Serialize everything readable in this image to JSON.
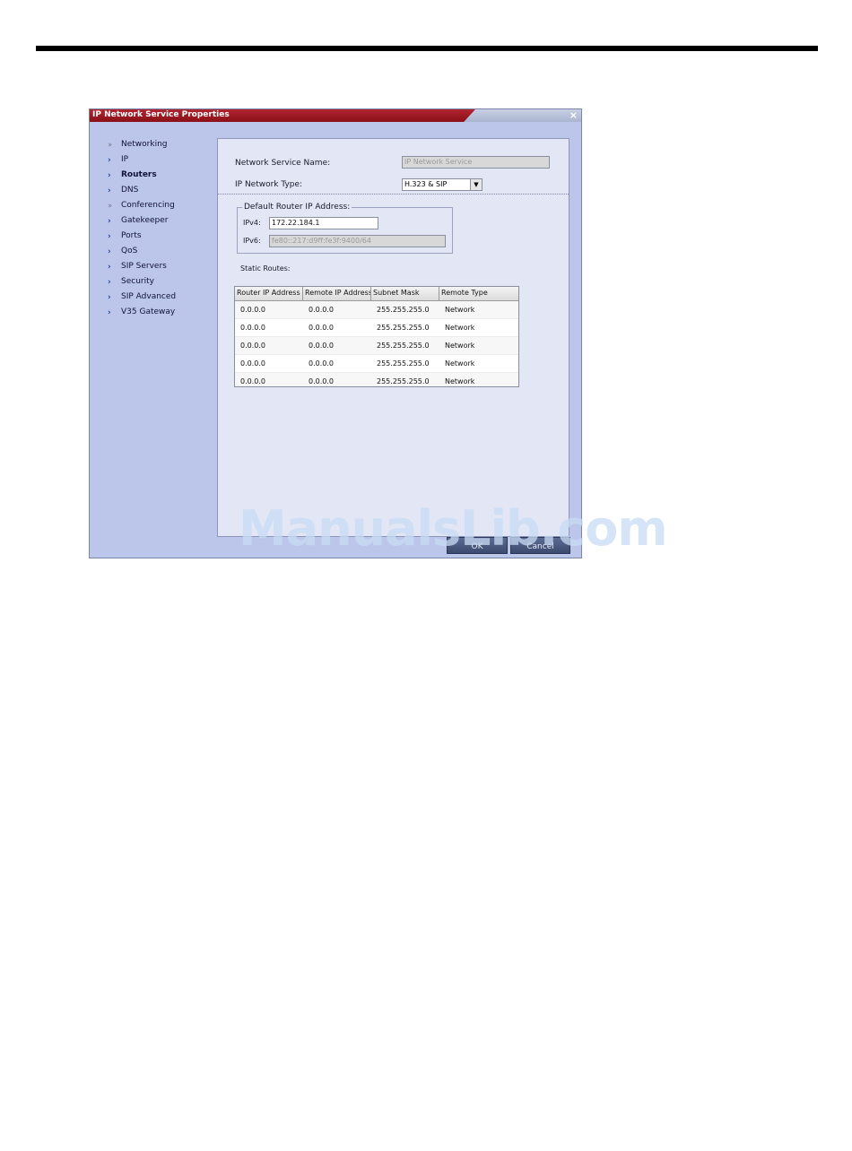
{
  "dialog": {
    "title": "IP Network Service Properties",
    "close_label": "×"
  },
  "nav": {
    "items": [
      {
        "label": "Networking",
        "arrow": "››",
        "section": true
      },
      {
        "label": "IP",
        "arrow": "›",
        "section": false
      },
      {
        "label": "Routers",
        "arrow": "›",
        "section": false,
        "active": true
      },
      {
        "label": "DNS",
        "arrow": "›",
        "section": false
      },
      {
        "label": "Conferencing",
        "arrow": "››",
        "section": true
      },
      {
        "label": "Gatekeeper",
        "arrow": "›",
        "section": false
      },
      {
        "label": "Ports",
        "arrow": "›",
        "section": false
      },
      {
        "label": "QoS",
        "arrow": "›",
        "section": false
      },
      {
        "label": "SIP Servers",
        "arrow": "›",
        "section": false
      },
      {
        "label": "Security",
        "arrow": "›",
        "section": false
      },
      {
        "label": "SIP Advanced",
        "arrow": "›",
        "section": false
      },
      {
        "label": "V35 Gateway",
        "arrow": "›",
        "section": false
      }
    ]
  },
  "form": {
    "service_name_label": "Network Service Name:",
    "service_name_value": "IP Network Service",
    "network_type_label": "IP Network Type:",
    "network_type_value": "H.323 & SIP",
    "default_router_label": "Default Router IP Address:",
    "ipv4_label": "IPv4:",
    "ipv4_value": "172.22.184.1",
    "ipv6_label": "IPv6:",
    "ipv6_value": "fe80::217:d9ff:fe3f:9400/64",
    "static_routes_label": "Static Routes:"
  },
  "routes_table": {
    "headers": [
      "Router IP Address",
      "Remote IP Address",
      "Subnet Mask",
      "Remote Type"
    ],
    "rows": [
      [
        "0.0.0.0",
        "0.0.0.0",
        "255.255.255.0",
        "Network"
      ],
      [
        "0.0.0.0",
        "0.0.0.0",
        "255.255.255.0",
        "Network"
      ],
      [
        "0.0.0.0",
        "0.0.0.0",
        "255.255.255.0",
        "Network"
      ],
      [
        "0.0.0.0",
        "0.0.0.0",
        "255.255.255.0",
        "Network"
      ],
      [
        "0.0.0.0",
        "0.0.0.0",
        "255.255.255.0",
        "Network"
      ]
    ]
  },
  "buttons": {
    "ok": "OK",
    "cancel": "Cancel"
  },
  "watermark": "ManualsLib.com",
  "colors": {
    "title_red": "#a51c26",
    "nav_bg": "#bcc6ea",
    "content_bg": "#e2e6f5",
    "button_bg": "#4b5a80"
  }
}
